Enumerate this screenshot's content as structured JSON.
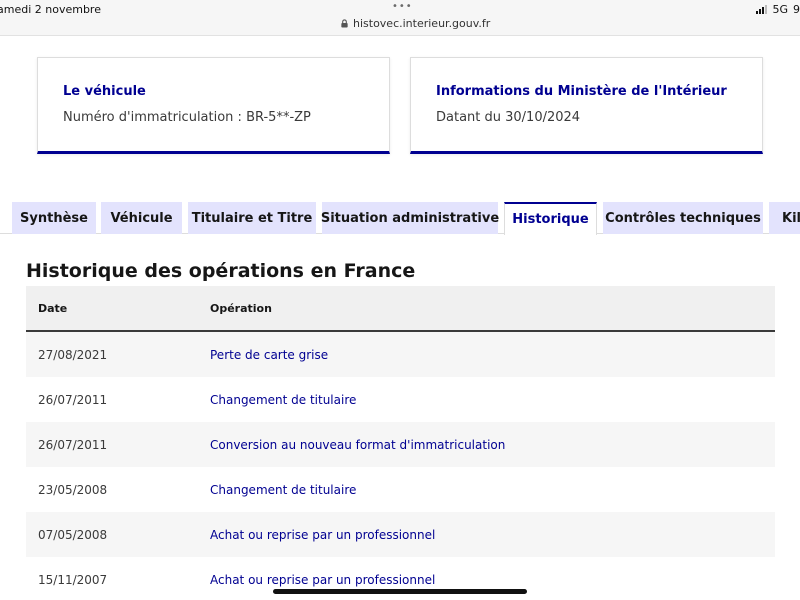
{
  "status_bar": {
    "date": "amedi 2 novembre",
    "dots": "•••",
    "url": "histovec.interieur.gouv.fr",
    "network": "5G",
    "battery_partial": "9"
  },
  "cards": {
    "vehicle": {
      "title": "Le véhicule",
      "text": "Numéro d'immatriculation : BR-5**-ZP"
    },
    "ministry": {
      "title": "Informations du Ministère de l'Intérieur",
      "text": "Datant du 30/10/2024"
    }
  },
  "tabs": [
    {
      "label": "Synthèse",
      "active": false
    },
    {
      "label": "Véhicule",
      "active": false
    },
    {
      "label": "Titulaire et Titre",
      "active": false
    },
    {
      "label": "Situation administrative",
      "active": false
    },
    {
      "label": "Historique",
      "active": true
    },
    {
      "label": "Contrôles techniques",
      "active": false
    },
    {
      "label": "Kil",
      "active": false
    }
  ],
  "main": {
    "title": "Historique des opérations en France",
    "table": {
      "headers": {
        "date": "Date",
        "operation": "Opération"
      },
      "rows": [
        {
          "date": "27/08/2021",
          "operation": "Perte de carte grise"
        },
        {
          "date": "26/07/2011",
          "operation": "Changement de titulaire"
        },
        {
          "date": "26/07/2011",
          "operation": "Conversion au nouveau format d'immatriculation"
        },
        {
          "date": "23/05/2008",
          "operation": "Changement de titulaire"
        },
        {
          "date": "07/05/2008",
          "operation": "Achat ou reprise par un professionnel"
        },
        {
          "date": "15/11/2007",
          "operation": "Achat ou reprise par un professionnel"
        }
      ]
    }
  },
  "colors": {
    "accent": "#000091",
    "tab_inactive_bg": "#e3e3fd",
    "row_alt_bg": "#f6f6f6"
  }
}
